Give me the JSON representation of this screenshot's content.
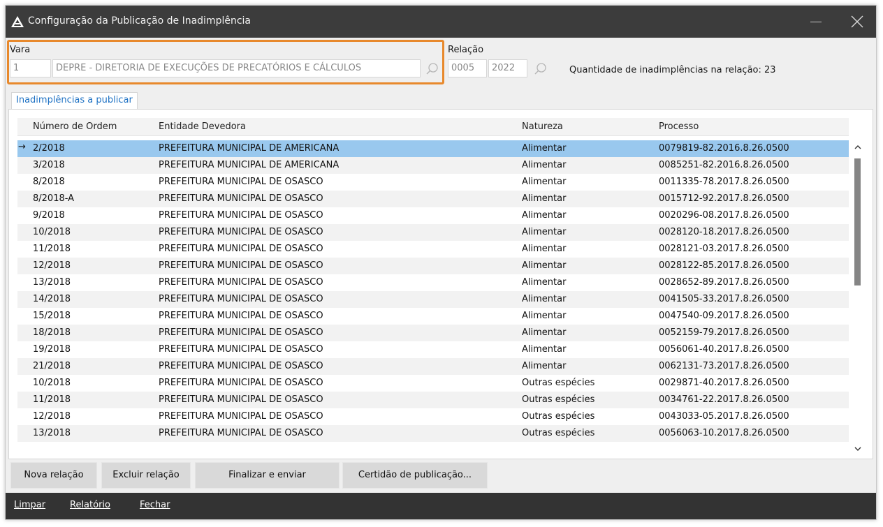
{
  "window": {
    "title": "Configuração da Publicação de Inadimplência"
  },
  "vara": {
    "label": "Vara",
    "code": "1",
    "description": "DEPRE - DIRETORIA DE EXECUÇÕES DE PRECATÓRIOS E CÁLCULOS"
  },
  "relacao": {
    "label": "Relação",
    "number": "0005",
    "year": "2022"
  },
  "quantity_text": "Quantidade de inadimplências na relação: 23",
  "tab": {
    "label": "Inadimplências a publicar"
  },
  "grid": {
    "columns": [
      "Número de Ordem",
      "Entidade Devedora",
      "Natureza",
      "Processo"
    ],
    "rows": [
      [
        "2/2018",
        "PREFEITURA MUNICIPAL DE AMERICANA",
        "Alimentar",
        "0079819-82.2016.8.26.0500"
      ],
      [
        "3/2018",
        "PREFEITURA MUNICIPAL DE AMERICANA",
        "Alimentar",
        "0085251-82.2016.8.26.0500"
      ],
      [
        "8/2018",
        "PREFEITURA MUNICIPAL DE OSASCO",
        "Alimentar",
        "0011335-78.2017.8.26.0500"
      ],
      [
        "8/2018-A",
        "PREFEITURA MUNICIPAL DE OSASCO",
        "Alimentar",
        "0015712-92.2017.8.26.0500"
      ],
      [
        "9/2018",
        "PREFEITURA MUNICIPAL DE OSASCO",
        "Alimentar",
        "0020296-08.2017.8.26.0500"
      ],
      [
        "10/2018",
        "PREFEITURA MUNICIPAL DE OSASCO",
        "Alimentar",
        "0028120-18.2017.8.26.0500"
      ],
      [
        "11/2018",
        "PREFEITURA MUNICIPAL DE OSASCO",
        "Alimentar",
        "0028121-03.2017.8.26.0500"
      ],
      [
        "12/2018",
        "PREFEITURA MUNICIPAL DE OSASCO",
        "Alimentar",
        "0028122-85.2017.8.26.0500"
      ],
      [
        "13/2018",
        "PREFEITURA MUNICIPAL DE OSASCO",
        "Alimentar",
        "0028652-89.2017.8.26.0500"
      ],
      [
        "14/2018",
        "PREFEITURA MUNICIPAL DE OSASCO",
        "Alimentar",
        "0041505-33.2017.8.26.0500"
      ],
      [
        "15/2018",
        "PREFEITURA MUNICIPAL DE OSASCO",
        "Alimentar",
        "0047540-09.2017.8.26.0500"
      ],
      [
        "18/2018",
        "PREFEITURA MUNICIPAL DE OSASCO",
        "Alimentar",
        "0052159-79.2017.8.26.0500"
      ],
      [
        "19/2018",
        "PREFEITURA MUNICIPAL DE OSASCO",
        "Alimentar",
        "0056061-40.2017.8.26.0500"
      ],
      [
        "21/2018",
        "PREFEITURA MUNICIPAL DE OSASCO",
        "Alimentar",
        "0062131-73.2017.8.26.0500"
      ],
      [
        "10/2018",
        "PREFEITURA MUNICIPAL DE OSASCO",
        "Outras espécies",
        "0029871-40.2017.8.26.0500"
      ],
      [
        "11/2018",
        "PREFEITURA MUNICIPAL DE OSASCO",
        "Outras espécies",
        "0034761-22.2017.8.26.0500"
      ],
      [
        "12/2018",
        "PREFEITURA MUNICIPAL DE OSASCO",
        "Outras espécies",
        "0043033-05.2017.8.26.0500"
      ],
      [
        "13/2018",
        "PREFEITURA MUNICIPAL DE OSASCO",
        "Outras espécies",
        "0056063-10.2017.8.26.0500"
      ]
    ],
    "current_row_marker": "→"
  },
  "buttons": {
    "nova_relacao": "Nova relação",
    "excluir_relacao": "Excluir relação",
    "finalizar_enviar": "Finalizar e enviar",
    "certidao": "Certidão de publicação..."
  },
  "footer": {
    "limpar": "Limpar",
    "relatorio": "Relatório",
    "fechar": "Fechar"
  },
  "colors": {
    "titlebar": "#3c3c3c",
    "selected_row": "#99c8ee",
    "tab_text": "#1f72c4",
    "focus_highlight": "#e8892c",
    "footer": "#333333"
  },
  "icons": {
    "app": "app-logo-icon",
    "close": "close-icon",
    "minimize": "minimize-icon",
    "search": "search-icon",
    "scroll_up": "chevron-up-icon",
    "scroll_down": "chevron-down-icon"
  }
}
